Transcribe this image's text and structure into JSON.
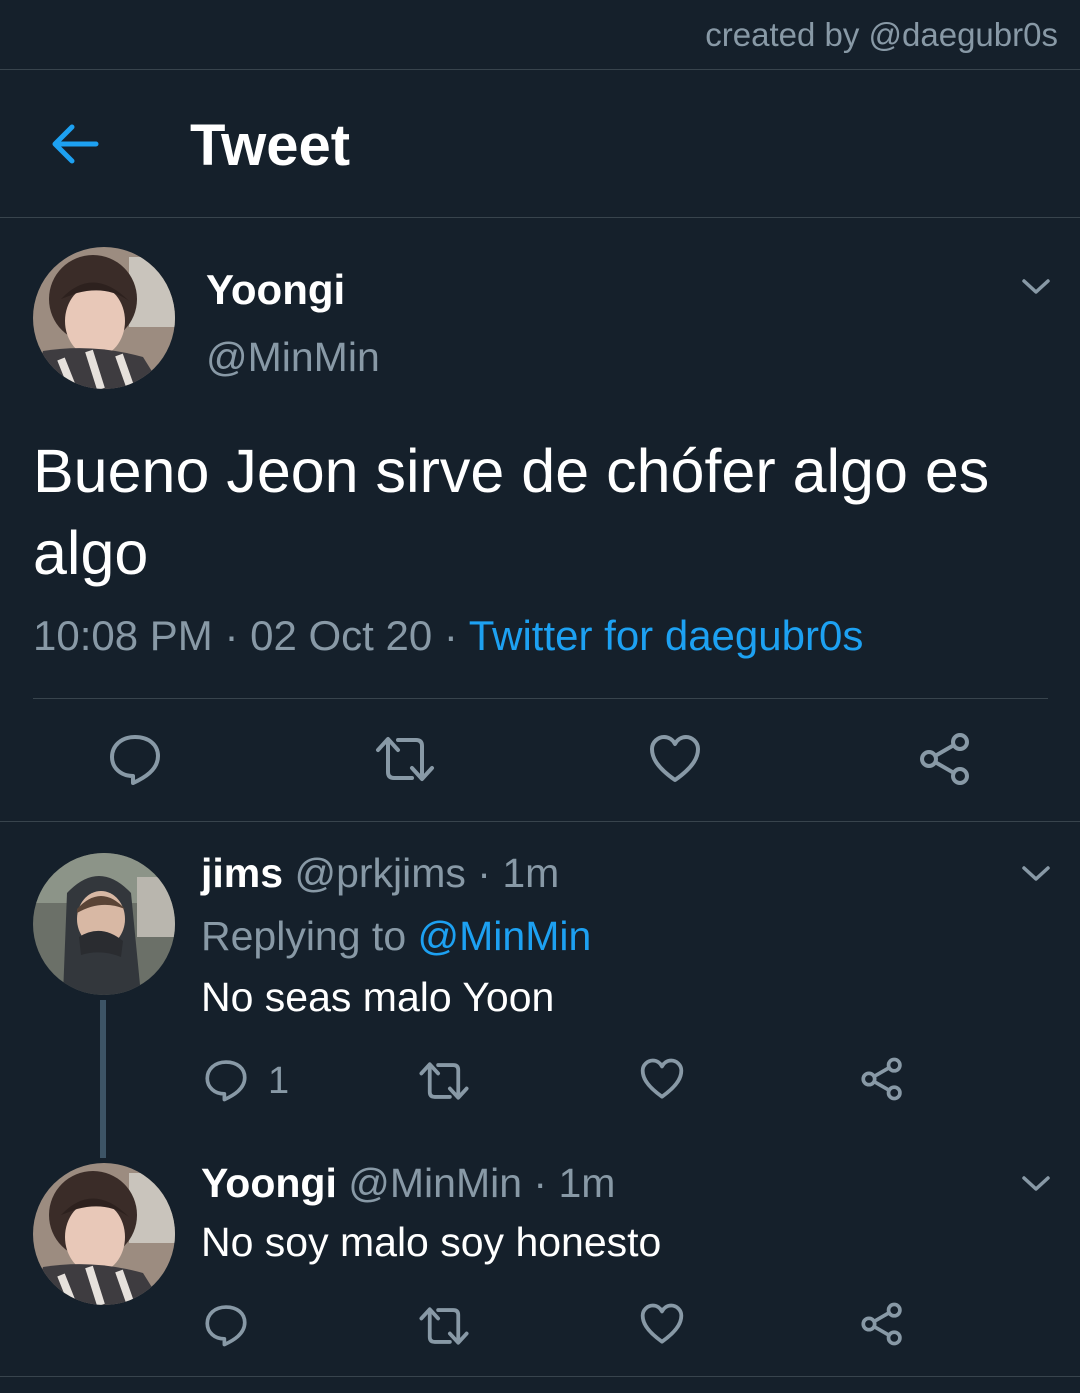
{
  "watermark": "created by @daegubr0s",
  "header": {
    "title": "Tweet",
    "back_icon": "arrow-left-icon"
  },
  "tweet": {
    "author_name": "Yoongi",
    "author_handle": "@MinMin",
    "text": "Bueno Jeon sirve de chófer algo es algo",
    "time": "10:08 PM",
    "date": "02 Oct 20",
    "source": "Twitter for daegubr0s",
    "separator": " · "
  },
  "replies": [
    {
      "author_name": "jims",
      "author_handle": "@prkjims",
      "age": "1m",
      "replying_label": "Replying to",
      "replying_to": "@MinMin",
      "text": "No seas malo Yoon",
      "reply_count": "1"
    },
    {
      "author_name": "Yoongi",
      "author_handle": "@MinMin",
      "age": "1m",
      "text": "No soy malo soy honesto"
    }
  ],
  "colors": {
    "background": "#15202b",
    "accent": "#1da1f2",
    "muted": "#8899a6",
    "divider": "#38444d"
  }
}
